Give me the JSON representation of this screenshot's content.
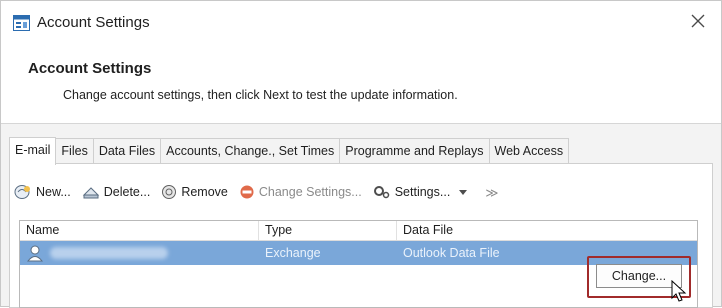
{
  "window": {
    "title": "Account Settings"
  },
  "header": {
    "title": "Account Settings",
    "subtitle": "Change account settings, then click Next to test the update information."
  },
  "tabs": [
    {
      "label": "E-mail",
      "active": true
    },
    {
      "label": "Files"
    },
    {
      "label": "Data Files"
    },
    {
      "label": "Accounts, Change., Set Times"
    },
    {
      "label": "Programme and Replays"
    },
    {
      "label": "Web Access"
    }
  ],
  "toolbar": {
    "new_label": "New...",
    "delete_label": "Delete...",
    "remove_label": "Remove",
    "change_settings_label": "Change Settings...",
    "settings_label": "Settings...",
    "more_glyph": "≫"
  },
  "list": {
    "columns": [
      "Name",
      "Type",
      "Data File"
    ],
    "rows": [
      {
        "name": "",
        "type": "Exchange",
        "data_file": "Outlook Data File"
      }
    ]
  },
  "change_button_label": "Change...",
  "colors": {
    "selection": "#7aa7d9",
    "highlight_border": "#a12b2b"
  }
}
